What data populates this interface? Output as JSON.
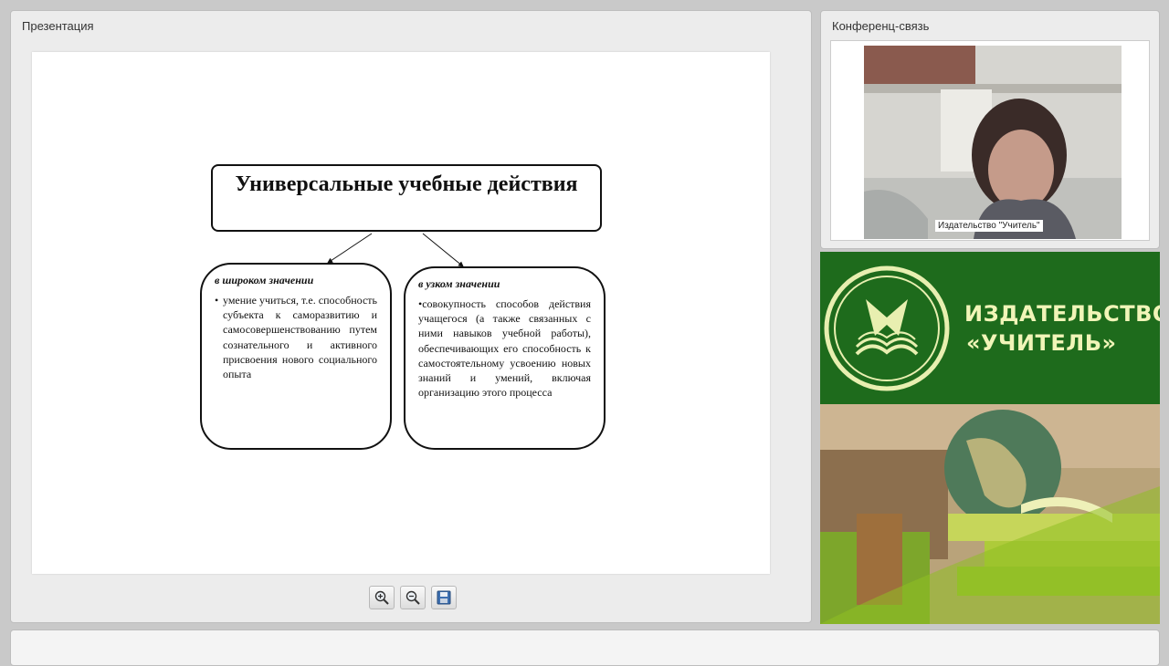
{
  "presentation": {
    "title": "Презентация",
    "slide": {
      "title": "Универсальные учебные действия",
      "left": {
        "heading": "в широком значении",
        "bullet": "•",
        "text": "умение учиться, т.е. способность субъекта к саморазвитию и самосовершенствованию путем сознательного и активного присвоения нового социального опыта"
      },
      "right": {
        "heading": "в узком значении",
        "text": "•совокупность способов действия учащегося (а также связанных с ними навыков учебной работы), обеспечивающих его способность к самостоятельному усвоению новых знаний и умений, включая организацию этого процесса"
      }
    },
    "toolbar": {
      "zoom_in_icon": "zoom-in-icon",
      "zoom_out_icon": "zoom-out-icon",
      "save_icon": "save-icon"
    }
  },
  "conference": {
    "title": "Конференц-связь",
    "participant_label": "Издательство \"Учитель\""
  },
  "brand": {
    "line1": "ИЗДАТЕЛЬСТВО",
    "line2": "«УЧИТЕЛЬ»",
    "colors": {
      "dark_green": "#1e6b1c",
      "cream": "#f1f5b8"
    }
  }
}
